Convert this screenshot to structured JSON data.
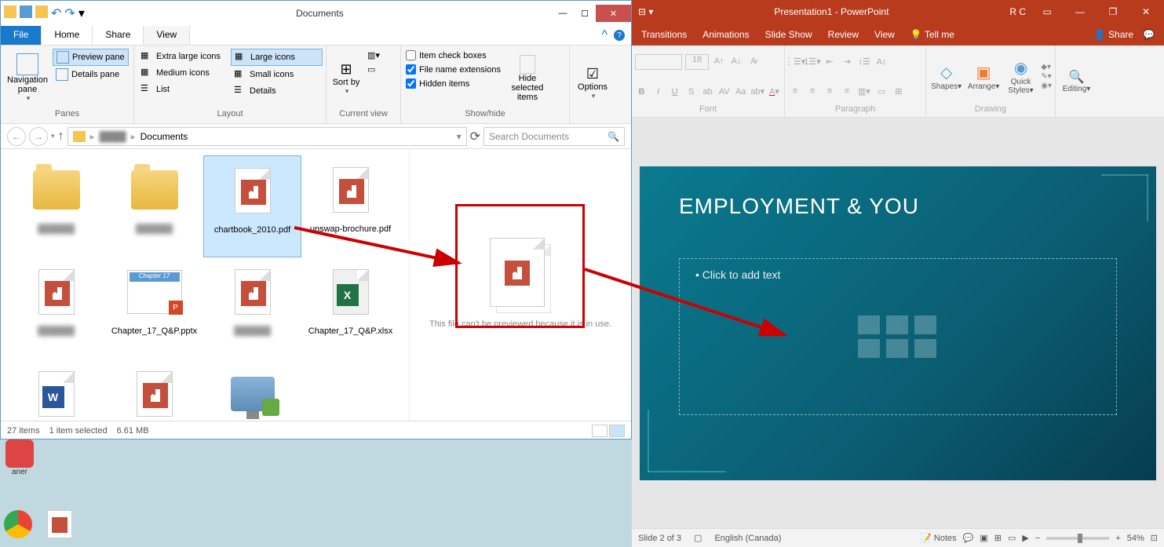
{
  "explorer": {
    "title": "Documents",
    "tabs": {
      "file": "File",
      "home": "Home",
      "share": "Share",
      "view": "View"
    },
    "ribbon": {
      "panes": {
        "nav": "Navigation pane",
        "preview": "Preview pane",
        "details": "Details pane",
        "label": "Panes"
      },
      "layout": {
        "xl": "Extra large icons",
        "lg": "Large icons",
        "md": "Medium icons",
        "sm": "Small icons",
        "list": "List",
        "det": "Details",
        "label": "Layout"
      },
      "curview": {
        "sort": "Sort by",
        "label": "Current view"
      },
      "showhide": {
        "cb": "Item check boxes",
        "ext": "File name extensions",
        "hidden": "Hidden items",
        "hidebtn": "Hide selected items",
        "label": "Show/hide"
      },
      "options": {
        "label": "Options"
      }
    },
    "breadcrumb": "Documents",
    "search_placeholder": "Search Documents",
    "files": [
      {
        "name": "",
        "type": "folder"
      },
      {
        "name": "",
        "type": "folder"
      },
      {
        "name": "chartbook_2010.pdf",
        "type": "pdf",
        "selected": true
      },
      {
        "name": "unswap-brochure.pdf",
        "type": "pdf"
      },
      {
        "name": "",
        "type": "pdf"
      },
      {
        "name": "Chapter_17_Q&P.pptx",
        "type": "pptx"
      },
      {
        "name": "",
        "type": "pdf"
      },
      {
        "name": "Chapter_17_Q&P.xlsx",
        "type": "xlsx"
      },
      {
        "name": "",
        "type": "docx"
      },
      {
        "name": "",
        "type": "pdf"
      },
      {
        "name": "",
        "type": "pc"
      }
    ],
    "preview_text": "This file can't be previewed because it is in use.",
    "status": {
      "items": "27 items",
      "selected": "1 item selected",
      "size": "6.61 MB"
    }
  },
  "ppt": {
    "title": "Presentation1 - PowerPoint",
    "user": "R C",
    "tabs": [
      "Transitions",
      "Animations",
      "Slide Show",
      "Review",
      "View",
      "Tell me"
    ],
    "share": "Share",
    "ribbon": {
      "font_size": "18",
      "groups": {
        "font": "Font",
        "para": "Paragraph",
        "drawing": "Drawing",
        "editing": "Editing"
      },
      "shapes": "Shapes",
      "arrange": "Arrange",
      "quick": "Quick Styles"
    },
    "slide": {
      "title": "EMPLOYMENT & YOU",
      "bullet": "Click to add text"
    },
    "status": {
      "slide": "Slide 2 of 3",
      "lang": "English (Canada)",
      "notes": "Notes",
      "zoom": "54%"
    }
  }
}
